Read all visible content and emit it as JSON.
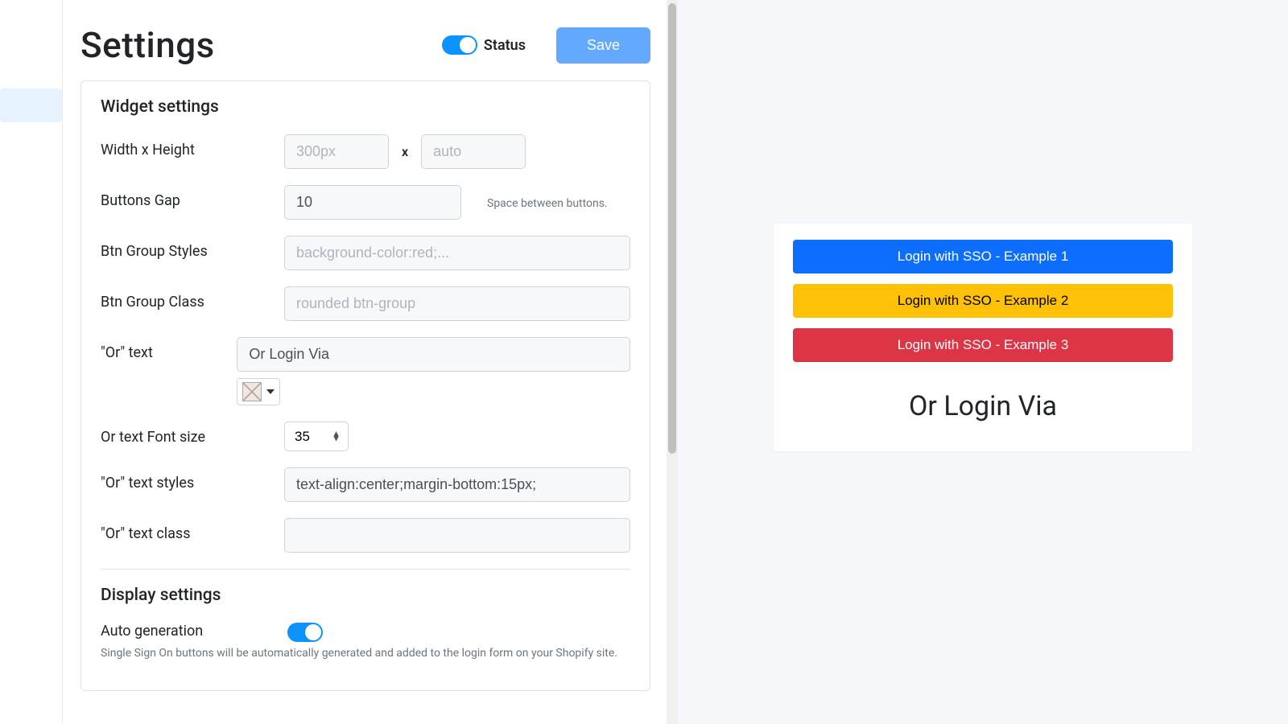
{
  "header": {
    "title": "Settings",
    "status_label": "Status",
    "status_on": true,
    "save_label": "Save"
  },
  "widget": {
    "section_title": "Widget settings",
    "fields": {
      "dimensions_label": "Width x Height",
      "width_placeholder": "300px",
      "x_separator": "x",
      "height_placeholder": "auto",
      "gap_label": "Buttons Gap",
      "gap_value": "10",
      "gap_helper": "Space between buttons.",
      "group_styles_label": "Btn Group Styles",
      "group_styles_placeholder": "background-color:red;...",
      "group_class_label": "Btn Group Class",
      "group_class_placeholder": "rounded btn-group",
      "or_text_label": "\"Or\" text",
      "or_text_value": "Or Login Via",
      "or_font_label": "Or text Font size",
      "or_font_value": "35",
      "or_styles_label": "\"Or\" text styles",
      "or_styles_value": "text-align:center;margin-bottom:15px;",
      "or_class_label": "\"Or\" text class",
      "or_class_value": ""
    }
  },
  "display": {
    "section_title": "Display settings",
    "auto_gen_label": "Auto generation",
    "auto_gen_on": true,
    "auto_gen_desc": "Single Sign On buttons will be automatically generated and added to the login form on your Shopify site."
  },
  "preview": {
    "buttons": [
      {
        "label": "Login with SSO - Example 1",
        "cls": "sso-1"
      },
      {
        "label": "Login with SSO - Example 2",
        "cls": "sso-2"
      },
      {
        "label": "Login with SSO - Example 3",
        "cls": "sso-3"
      }
    ],
    "or_text": "Or Login Via"
  },
  "colors": {
    "primary": "#0d6efd",
    "warning": "#ffc107",
    "danger": "#dc3545",
    "toggle": "#0d93ff",
    "save": "#62a9ff"
  }
}
